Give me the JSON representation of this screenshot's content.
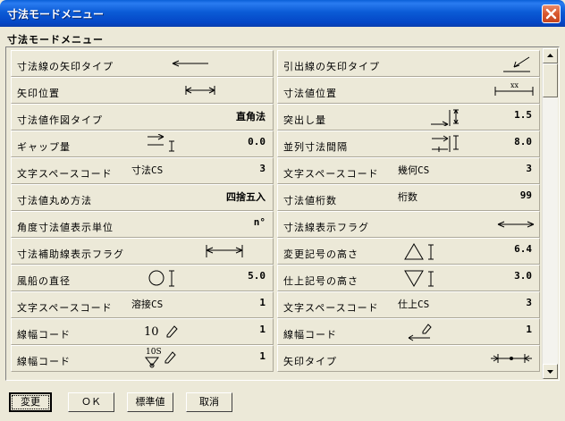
{
  "window": {
    "title": "寸法モードメニュー"
  },
  "menu_label": "寸法モードメニュー",
  "colors": {
    "titlebar": "#0b5bd6",
    "close": "#d8582e",
    "face": "#ece9d8"
  },
  "rows": [
    {
      "left": {
        "label": "寸法線の矢印タイプ",
        "mid": "",
        "value": "",
        "icon": "arrow-left-icon"
      },
      "right": {
        "label": "引出線の矢印タイプ",
        "mid": "",
        "value": "",
        "icon": "leader-arrow-icon"
      }
    },
    {
      "left": {
        "label": "矢印位置",
        "mid": "",
        "value": "",
        "icon": "arrow-position-icon"
      },
      "right": {
        "label": "寸法値位置",
        "mid": "",
        "value": "",
        "icon": "dim-value-position-icon"
      }
    },
    {
      "left": {
        "label": "寸法値作図タイプ",
        "mid": "",
        "value": "直角法",
        "icon": ""
      },
      "right": {
        "label": "突出し量",
        "mid": "",
        "value": "1.5",
        "icon": "overshoot-icon"
      }
    },
    {
      "left": {
        "label": "ギャップ量",
        "mid": "",
        "value": "0.0",
        "icon": "gap-icon"
      },
      "right": {
        "label": "並列寸法間隔",
        "mid": "",
        "value": "8.0",
        "icon": "parallel-spacing-icon"
      }
    },
    {
      "left": {
        "label": "文字スペースコード",
        "mid": "寸法CS",
        "value": "3",
        "icon": ""
      },
      "right": {
        "label": "文字スペースコード",
        "mid": "幾何CS",
        "value": "3",
        "icon": ""
      }
    },
    {
      "left": {
        "label": "寸法値丸め方法",
        "mid": "",
        "value": "四捨五入",
        "icon": ""
      },
      "right": {
        "label": "寸法値桁数",
        "mid": "桁数",
        "value": "99",
        "icon": ""
      }
    },
    {
      "left": {
        "label": "角度寸法値表示単位",
        "mid": "",
        "value": "n°",
        "icon": ""
      },
      "right": {
        "label": "寸法線表示フラグ",
        "mid": "",
        "value": "",
        "icon": "double-arrow-icon"
      }
    },
    {
      "left": {
        "label": "寸法補助線表示フラグ",
        "mid": "",
        "value": "",
        "icon": "extension-line-icon"
      },
      "right": {
        "label": "変更記号の高さ",
        "mid": "",
        "value": "6.4",
        "icon": "triangle-up-icon"
      }
    },
    {
      "left": {
        "label": "風船の直径",
        "mid": "",
        "value": "5.0",
        "icon": "circle-icon"
      },
      "right": {
        "label": "仕上記号の高さ",
        "mid": "",
        "value": "3.0",
        "icon": "triangle-down-icon"
      }
    },
    {
      "left": {
        "label": "文字スペースコード",
        "mid": "溶接CS",
        "value": "1",
        "icon": ""
      },
      "right": {
        "label": "文字スペースコード",
        "mid": "仕上CS",
        "value": "3",
        "icon": ""
      }
    },
    {
      "left": {
        "label": "線幅コード",
        "mid": "",
        "value": "1",
        "icon": "pen-10-icon"
      },
      "right": {
        "label": "線幅コード",
        "mid": "",
        "value": "1",
        "icon": "pen-arrow-icon"
      }
    },
    {
      "left": {
        "label": "線幅コード",
        "mid": "",
        "value": "1",
        "icon": "pen-weld-icon"
      },
      "right": {
        "label": "矢印タイプ",
        "mid": "",
        "value": "",
        "icon": "arrow-dot-icon"
      }
    }
  ],
  "symbols": {
    "ten": "10",
    "weld": "10S",
    "xx": "xx"
  },
  "buttons": {
    "change": "変更",
    "ok": "ＯＫ",
    "default": "標準値",
    "cancel": "取消"
  }
}
